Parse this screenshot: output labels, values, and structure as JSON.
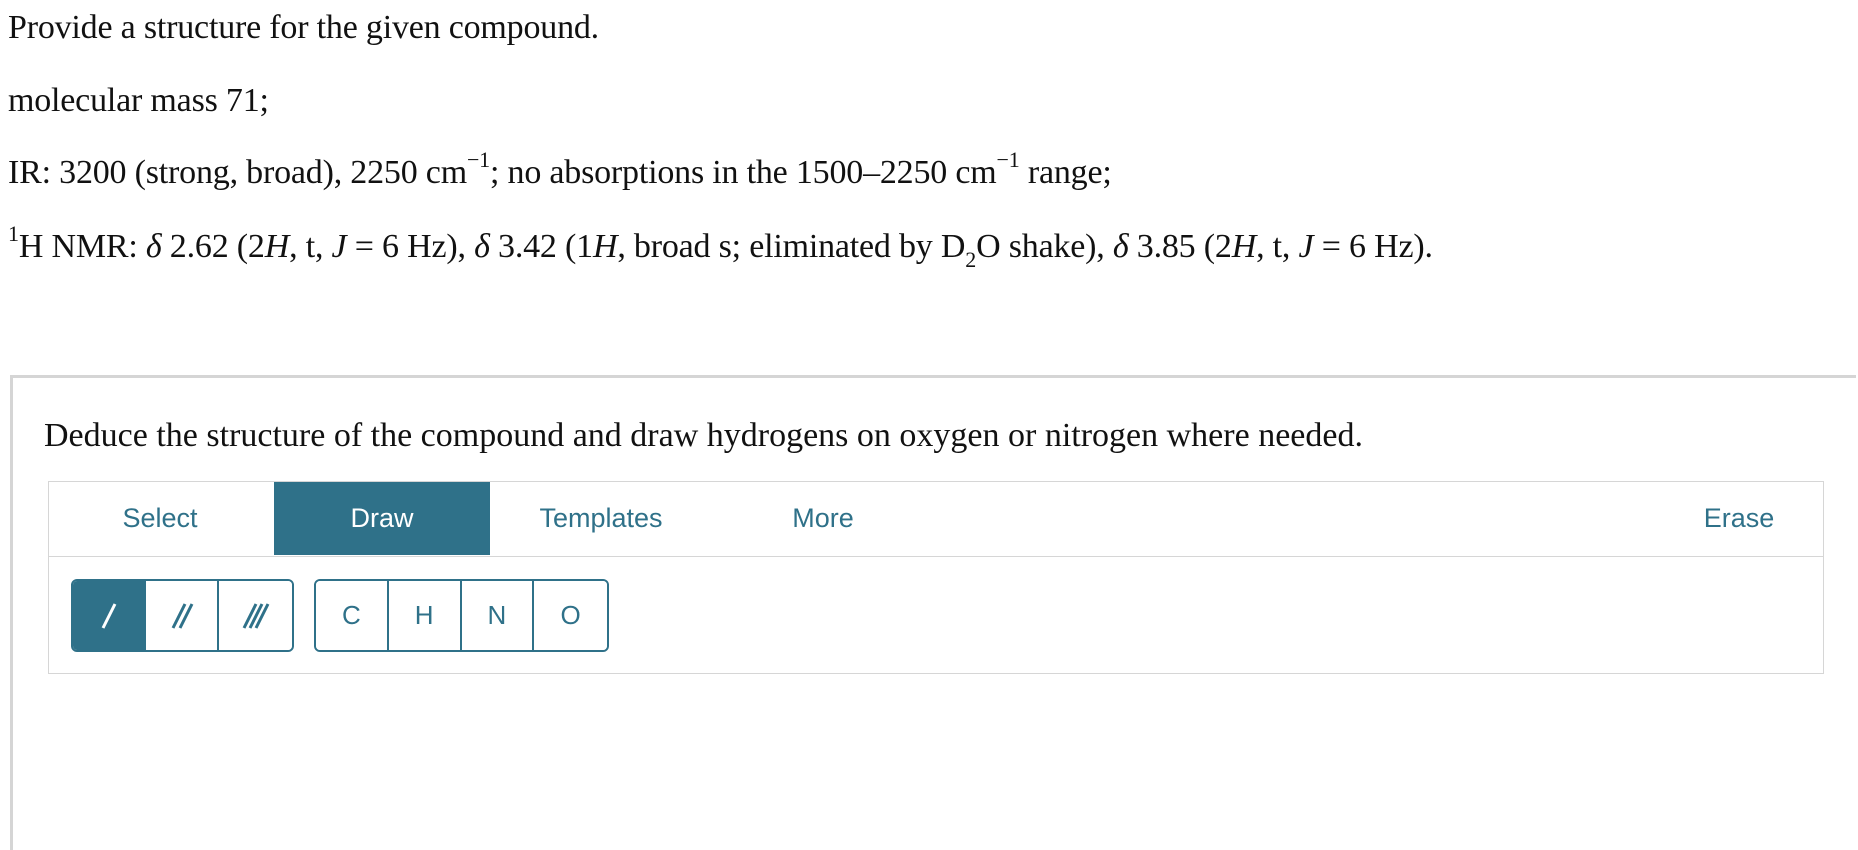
{
  "question": {
    "prompt": "Provide a structure for the given compound.",
    "mass": "molecular mass 71;",
    "ir": {
      "p1": "IR: 3200 (strong, broad), 2250 cm",
      "sup1": "−1",
      "p2": "; no absorptions in the 1500–2250 cm",
      "sup2": "−1",
      "p3": " range;"
    },
    "nmr": {
      "sup": "1",
      "a": "H NMR: ",
      "delta1": "δ",
      "b": " 2.62 (2",
      "H1": "H",
      "c": ", t, ",
      "J1": "J",
      "d": " = 6 Hz), ",
      "delta2": "δ",
      "e": " 3.42 (1",
      "H2": "H",
      "f": ", broad s; eliminated by D",
      "sub": "2",
      "g": "O shake), ",
      "delta3": "δ",
      "h": " 3.85 (2",
      "H3": "H",
      "i": ", t, ",
      "J2": "J",
      "j": " = 6 Hz)."
    }
  },
  "instruction": "Deduce the structure of the compound and draw hydrogens on oxygen or nitrogen where needed.",
  "toolbar": {
    "select": "Select",
    "draw": "Draw",
    "templates": "Templates",
    "more": "More",
    "erase": "Erase"
  },
  "bonds": [
    "single-bond-icon",
    "double-bond-icon",
    "triple-bond-icon"
  ],
  "atoms": [
    "C",
    "H",
    "N",
    "O"
  ],
  "colors": {
    "accent": "#2f7189",
    "border": "#d6d6d6"
  }
}
